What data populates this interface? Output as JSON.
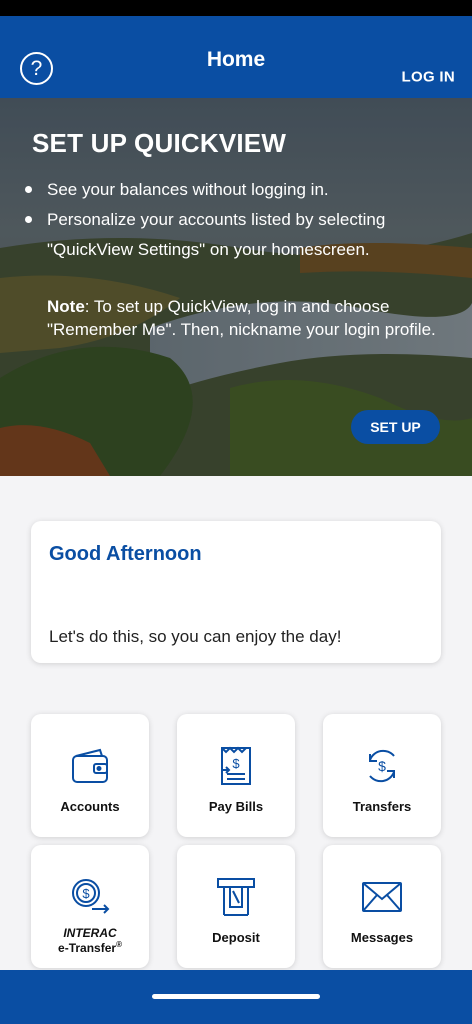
{
  "header": {
    "title": "Home",
    "login_label": "LOG IN",
    "help_icon": "?"
  },
  "hero": {
    "title": "SET UP QUICKVIEW",
    "bullets": [
      "See your balances without logging in.",
      "Personalize your accounts listed by selecting \"QuickView Settings\" on your homescreen."
    ],
    "note_label": "Note",
    "note_text": ": To set up QuickView, log in and choose \"Remember Me\". Then, nickname your login profile.",
    "setup_label": "SET UP"
  },
  "greeting": {
    "title": "Good Afternoon",
    "subtitle": "Let's do this, so you can enjoy the day!"
  },
  "tiles": [
    {
      "label": "Accounts",
      "icon": "wallet-icon"
    },
    {
      "label": "Pay Bills",
      "icon": "bill-icon"
    },
    {
      "label": "Transfers",
      "icon": "transfer-icon"
    },
    {
      "label_line1": "INTERAC",
      "label_line2": "e-Transfer",
      "label_sup": "®",
      "icon": "etransfer-icon"
    },
    {
      "label": "Deposit",
      "icon": "atm-icon"
    },
    {
      "label": "Messages",
      "icon": "envelope-icon"
    }
  ],
  "colors": {
    "brand_blue": "#0a4ea3"
  }
}
